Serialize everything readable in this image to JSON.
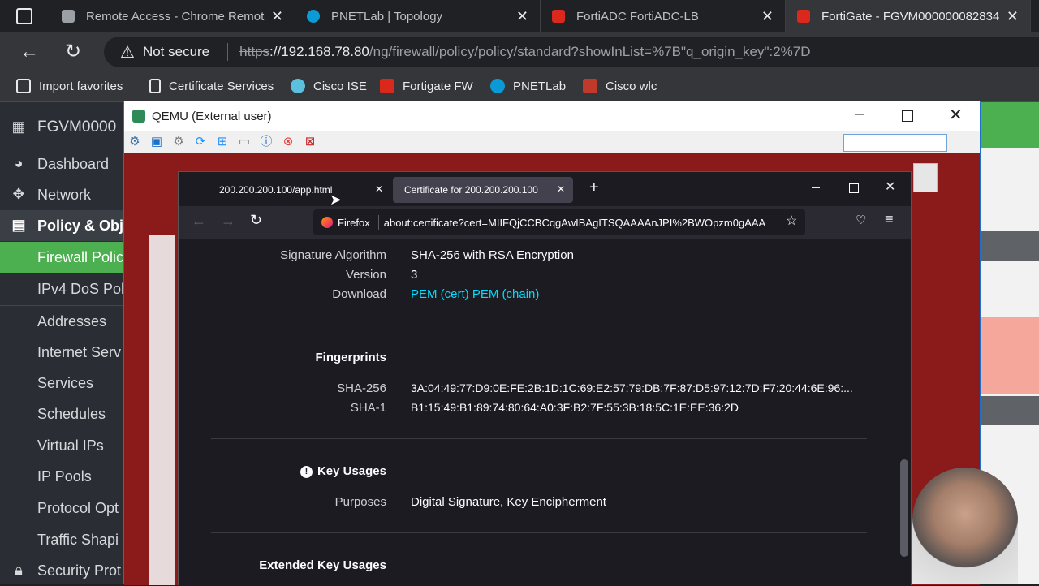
{
  "chrome": {
    "tabs": [
      {
        "title": "Remote Access - Chrome Remote",
        "close": "✕"
      },
      {
        "title": "PNETLab | Topology",
        "close": "✕"
      },
      {
        "title": "FortiADC FortiADC-LB",
        "close": "✕"
      },
      {
        "title": "FortiGate - FGVM000000082834",
        "close": "✕"
      }
    ],
    "security": "Not secure",
    "url_scheme": "https",
    "url_host": "://192.168.78.80",
    "url_path": "/ng/firewall/policy/policy/standard?showInList=%7B\"q_origin_key\":2%7D",
    "bookmarks": [
      "Import favorites",
      "Certificate Services",
      "Cisco ISE",
      "Fortigate FW",
      "PNETLab",
      "Cisco wlc"
    ]
  },
  "fortigate": {
    "device": "FGVM0000",
    "top": [
      "Dashboard",
      "Network",
      "Policy & Obj"
    ],
    "sub": [
      "Firewall Polic",
      "IPv4 DoS Pol",
      "Addresses",
      "Internet Serv",
      "Services",
      "Schedules",
      "Virtual IPs",
      "IP Pools",
      "Protocol Opt",
      "Traffic Shapi"
    ],
    "bottom": "Security Prot"
  },
  "qemu": {
    "title": "QEMU (External user)"
  },
  "firefox": {
    "tabs": [
      {
        "title": "200.200.200.100/app.html"
      },
      {
        "title": "Certificate for 200.200.200.100"
      }
    ],
    "new_tab": "+",
    "firefox_label": "Firefox",
    "url": "about:certificate?cert=MIIFQjCCBCqgAwIBAgITSQAAAAnJPI%2BWOpzm0gAAA",
    "cert": {
      "rows": [
        {
          "label": "Signature Algorithm",
          "value": "SHA-256 with RSA Encryption"
        },
        {
          "label": "Version",
          "value": "3"
        }
      ],
      "download_label": "Download",
      "download_cert": "PEM (cert)",
      "download_chain": "PEM (chain)",
      "fingerprints_heading": "Fingerprints",
      "sha256_label": "SHA-256",
      "sha256_value": "3A:04:49:77:D9:0E:FE:2B:1D:1C:69:E2:57:79:DB:7F:87:D5:97:12:7D:F7:20:44:6E:96:...",
      "sha1_label": "SHA-1",
      "sha1_value": "B1:15:49:B1:89:74:80:64:A0:3F:B2:7F:55:3B:18:5C:1E:EE:36:2D",
      "key_usages_heading": "Key Usages",
      "purposes_label": "Purposes",
      "purposes_value": "Digital Signature, Key Encipherment",
      "ext_key_usages_heading": "Extended Key Usages"
    }
  },
  "colors": {
    "fortinet_red": "#da291c",
    "fg_green": "#4caf50",
    "link": "#00ddff"
  }
}
